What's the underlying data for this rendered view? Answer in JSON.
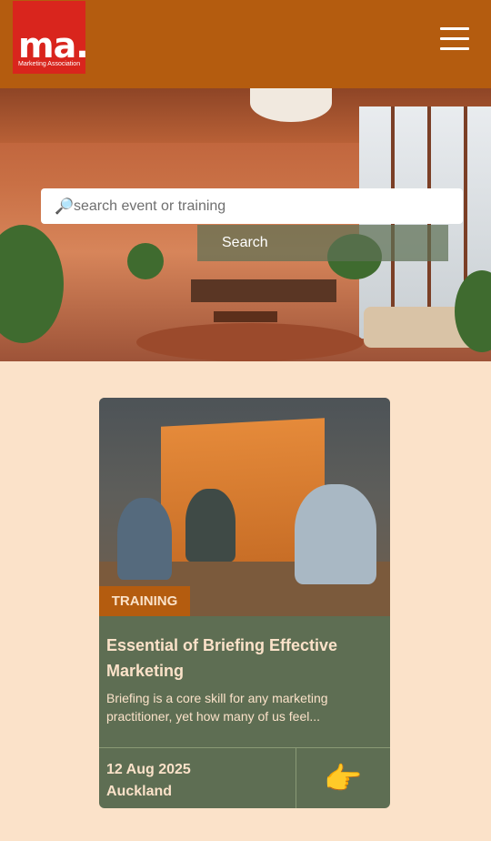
{
  "header": {
    "logo_main": "ma.",
    "logo_sub": "Marketing Association",
    "menu_icon": "hamburger-icon"
  },
  "search": {
    "icon": "🔎",
    "placeholder": "search event or training",
    "button_label": "Search"
  },
  "card": {
    "badge": "TRAINING",
    "title": "Essential of Briefing Effective Marketing",
    "description": "Briefing is a core skill for any marketing practitioner, yet how many of us feel...",
    "date": "12 Aug 2025",
    "location": "Auckland",
    "arrow": "👉"
  },
  "colors": {
    "header_bg": "#b45c0f",
    "logo_bg": "#d9251d",
    "page_bg": "#fbe2c9",
    "card_bg": "#5e6e53"
  }
}
